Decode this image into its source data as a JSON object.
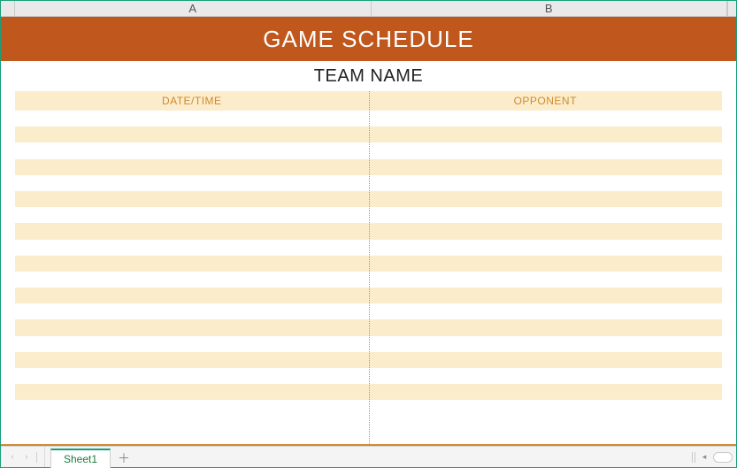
{
  "columns": {
    "A": "A",
    "B": "B"
  },
  "title": "GAME SCHEDULE",
  "subtitle": "TEAM NAME",
  "table": {
    "headers": {
      "date_time": "DATE/TIME",
      "opponent": "OPPONENT"
    },
    "rows": [
      {
        "date_time": "",
        "opponent": ""
      },
      {
        "date_time": "",
        "opponent": ""
      },
      {
        "date_time": "",
        "opponent": ""
      },
      {
        "date_time": "",
        "opponent": ""
      },
      {
        "date_time": "",
        "opponent": ""
      },
      {
        "date_time": "",
        "opponent": ""
      },
      {
        "date_time": "",
        "opponent": ""
      },
      {
        "date_time": "",
        "opponent": ""
      },
      {
        "date_time": "",
        "opponent": ""
      },
      {
        "date_time": "",
        "opponent": ""
      },
      {
        "date_time": "",
        "opponent": ""
      },
      {
        "date_time": "",
        "opponent": ""
      },
      {
        "date_time": "",
        "opponent": ""
      },
      {
        "date_time": "",
        "opponent": ""
      },
      {
        "date_time": "",
        "opponent": ""
      },
      {
        "date_time": "",
        "opponent": ""
      },
      {
        "date_time": "",
        "opponent": ""
      },
      {
        "date_time": "",
        "opponent": ""
      },
      {
        "date_time": "",
        "opponent": ""
      }
    ]
  },
  "tabs": {
    "active": "Sheet1"
  },
  "icons": {
    "nav_first": "◂",
    "nav_prev": "‹",
    "nav_next": "›",
    "nav_last": "▸",
    "add": "＋",
    "scroll_left": "◂"
  },
  "colors": {
    "title_bg": "#c0571d",
    "stripe": "#fbeccc",
    "header_text": "#d28a2c",
    "accent": "#1a9e79"
  }
}
